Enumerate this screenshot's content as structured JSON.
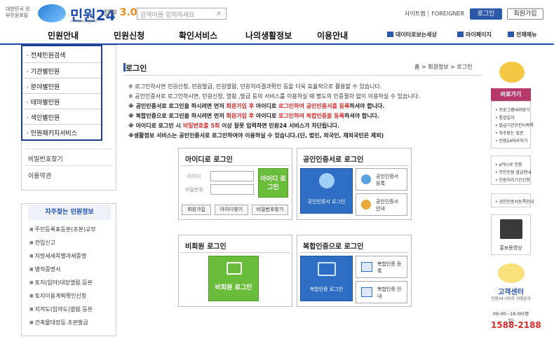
{
  "header": {
    "gov_text": "대한민국 정부민원포털",
    "logo": "민원24",
    "logo_sub": "minwon.go.kr",
    "gov30_prefix": "정부",
    "gov30_num": "3.0",
    "search_placeholder": "검색어를 입력하세요",
    "links": [
      "사이트맵",
      "FOREIGNER"
    ],
    "login": "로그인",
    "join": "회원가입"
  },
  "nav": {
    "items": [
      "민원안내",
      "민원신청",
      "확인서비스",
      "나의생활정보",
      "이용안내"
    ],
    "right": [
      "데이터로보는세상",
      "마이페이지",
      "전체메뉴"
    ]
  },
  "dropdown": [
    "전체민원검색",
    "기관별민원",
    "분야별민원",
    "테마별민원",
    "색인별민원",
    "민원패키지서비스"
  ],
  "left_menu": [
    "비밀번호찾기",
    "이용약관"
  ],
  "faq": {
    "title": "자주찾는 민원정보",
    "items": [
      "주민등록표등본(초본)교부",
      "전입신고",
      "지방세세목별과세증명",
      "병적증명서",
      "토지(임야)대장열람.등본",
      "토지이용계획확인신청",
      "지적도(임야도)열람.등본",
      "건축물대장등.초본발급"
    ]
  },
  "main": {
    "title": "로그인",
    "breadcrumb": "홈 > 회원정보 > 로그인",
    "notices": [
      {
        "text": "※ 로그인하시면 민원신청, 민원발급, 민원열람, 민원처리결과확인 등을 더욱 효율적으로 활용할 수 있습니다."
      },
      {
        "text": "※ 공인인증서로 로그인하시면, 민원신청, 열람 ,발급 등의 서비스를 이용하실 때 별도의 인증절차 없이 이용하실 수 있습니다."
      },
      {
        "parts": [
          "※ 공인인증서로 로그인을 하시려면 먼저 ",
          "회원가입 후",
          " 아이디로 ",
          "로그인하여 공인인증서를 등록",
          "하셔야 합니다."
        ]
      },
      {
        "parts": [
          "※ 복합인증으로 로그인을 하시려면 먼저 ",
          "회원가입 후",
          " 아이디로 ",
          "로그인하여 복합인증을 등록",
          "하셔야 합니다."
        ]
      },
      {
        "parts": [
          "※ 아이디로 로그인 시 ",
          "비밀번호를 5회",
          " 이상 잘못 입력하면 민원24 서비스가 차단됩니다."
        ]
      },
      {
        "text": "※생활정보 서비스는 공인인증서로 로그인하여야 이용하실 수 있습니다.(단, 법인, 외국인, 재외국민은 제외)"
      }
    ],
    "id_login": {
      "title": "아이디로 로그인",
      "id_label": "아이디",
      "pw_label": "비밀번호",
      "login_btn": "아이디 로그인",
      "buttons": [
        "회원가입",
        "아이디찾기",
        "비밀번호찾기"
      ]
    },
    "cert_login": {
      "title": "공인인증서로 로그인",
      "login_btn": "공인인증서 로그인",
      "register": "공인인증서 등록",
      "guide": "공인인증서 안내"
    },
    "nonmember": {
      "title": "비회원 로그인",
      "btn": "비회원 로그인"
    },
    "complex": {
      "title": "복합인증으로 로그인",
      "login_btn": "복합인증 로그인",
      "register": "복합인증 등록",
      "guide": "복합인증 안내"
    }
  },
  "right": {
    "header1": "바로가기",
    "links1": [
      "프로그램내려받기",
      "통합설치",
      "발급기관프린터목록",
      "자주묻는 질문",
      "민원24따라하기"
    ],
    "links2": [
      "e하나로 민원",
      "무인민원 발급안내",
      "민원처리기간신청"
    ],
    "link3": "공인인증서등록안내",
    "promo": "홍보동영상",
    "callcenter": "고객센터",
    "call_sub": "민원24 사이트 이용문의",
    "hours": "09:00~18:00(평일)",
    "phone": "1588-2188"
  }
}
